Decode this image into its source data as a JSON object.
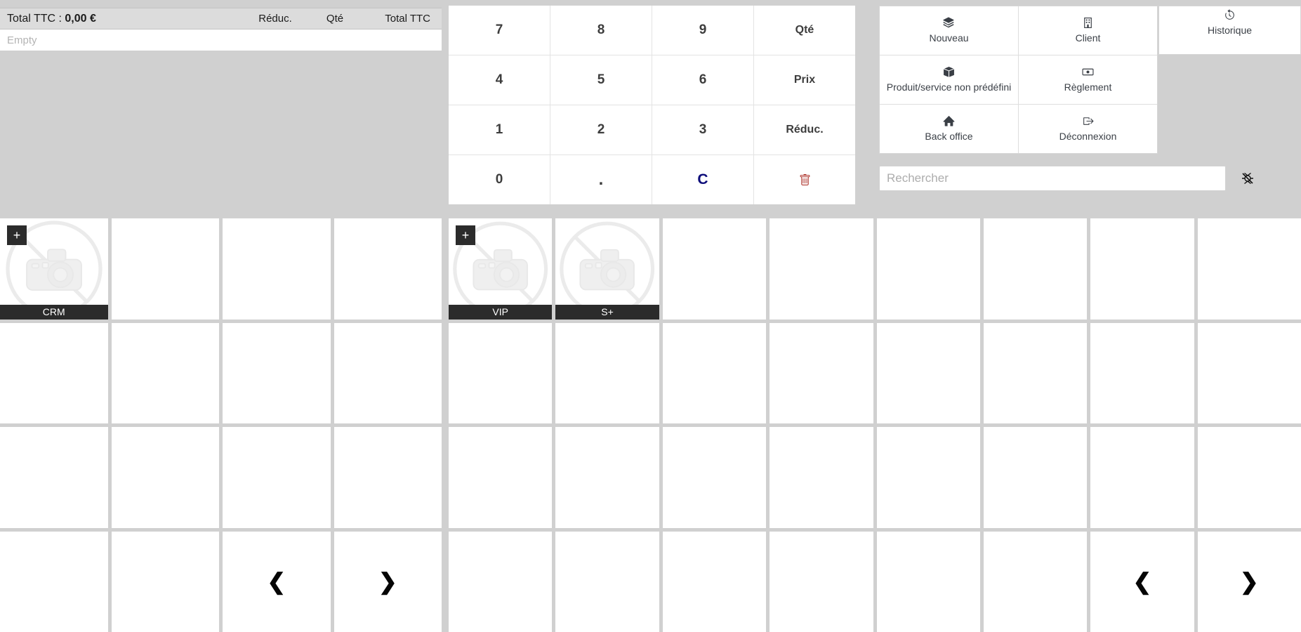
{
  "cart": {
    "total_label": "Total TTC : ",
    "total_value": "0,00 €",
    "col_reduc": "Réduc.",
    "col_qte": "Qté",
    "col_total": "Total TTC",
    "empty_text": "Empty"
  },
  "numpad": {
    "keys": [
      {
        "label": "7",
        "kind": "digit"
      },
      {
        "label": "8",
        "kind": "digit"
      },
      {
        "label": "9",
        "kind": "digit"
      },
      {
        "label": "Qté",
        "kind": "action"
      },
      {
        "label": "4",
        "kind": "digit"
      },
      {
        "label": "5",
        "kind": "digit"
      },
      {
        "label": "6",
        "kind": "digit"
      },
      {
        "label": "Prix",
        "kind": "action"
      },
      {
        "label": "1",
        "kind": "digit"
      },
      {
        "label": "2",
        "kind": "digit"
      },
      {
        "label": "3",
        "kind": "digit"
      },
      {
        "label": "Réduc.",
        "kind": "action"
      },
      {
        "label": "0",
        "kind": "digit"
      },
      {
        "label": ".",
        "kind": "dot"
      },
      {
        "label": "C",
        "kind": "clear"
      },
      {
        "label": "",
        "kind": "trash",
        "icon": "trash-icon"
      }
    ]
  },
  "actions": {
    "buttons": [
      {
        "label": "Nouveau",
        "icon": "layers-icon"
      },
      {
        "label": "Client",
        "icon": "building-icon"
      },
      {
        "label": "Produit/service non prédéfini",
        "icon": "box-icon"
      },
      {
        "label": "Règlement",
        "icon": "banknote-icon"
      },
      {
        "label": "Back office",
        "icon": "home-icon"
      },
      {
        "label": "Déconnexion",
        "icon": "logout-icon"
      }
    ],
    "history": {
      "label": "Historique",
      "icon": "history-icon"
    }
  },
  "search": {
    "placeholder": "Rechercher",
    "value": "",
    "side_icon": "broken-image-icon"
  },
  "grids": {
    "left": {
      "columns": 4,
      "rows": 4,
      "cells": [
        {
          "label": "CRM",
          "image": "no-camera-placeholder",
          "badge": "+"
        },
        {},
        {},
        {},
        {},
        {},
        {},
        {},
        {},
        {},
        {},
        {},
        {},
        {},
        {
          "nav": "prev",
          "glyph": "❮"
        },
        {
          "nav": "next",
          "glyph": "❯"
        }
      ]
    },
    "right": {
      "columns": 8,
      "rows": 4,
      "cells": [
        {
          "label": "VIP",
          "image": "no-camera-placeholder",
          "badge": "+"
        },
        {
          "label": "S+",
          "image": "no-camera-placeholder"
        },
        {},
        {},
        {},
        {},
        {},
        {},
        {},
        {},
        {},
        {},
        {},
        {},
        {},
        {},
        {},
        {},
        {},
        {},
        {},
        {},
        {},
        {},
        {},
        {},
        {},
        {},
        {},
        {},
        {
          "nav": "prev",
          "glyph": "❮"
        },
        {
          "nav": "next",
          "glyph": "❯"
        }
      ]
    }
  },
  "colors": {
    "page_bg": "#d0d0d0",
    "panel_bg": "#ffffff",
    "header_bg": "#dcdcdc",
    "clear_key": "#0d0d7a",
    "trash_icon": "#b03a32",
    "tile_label_bg": "#2b2b2b"
  }
}
